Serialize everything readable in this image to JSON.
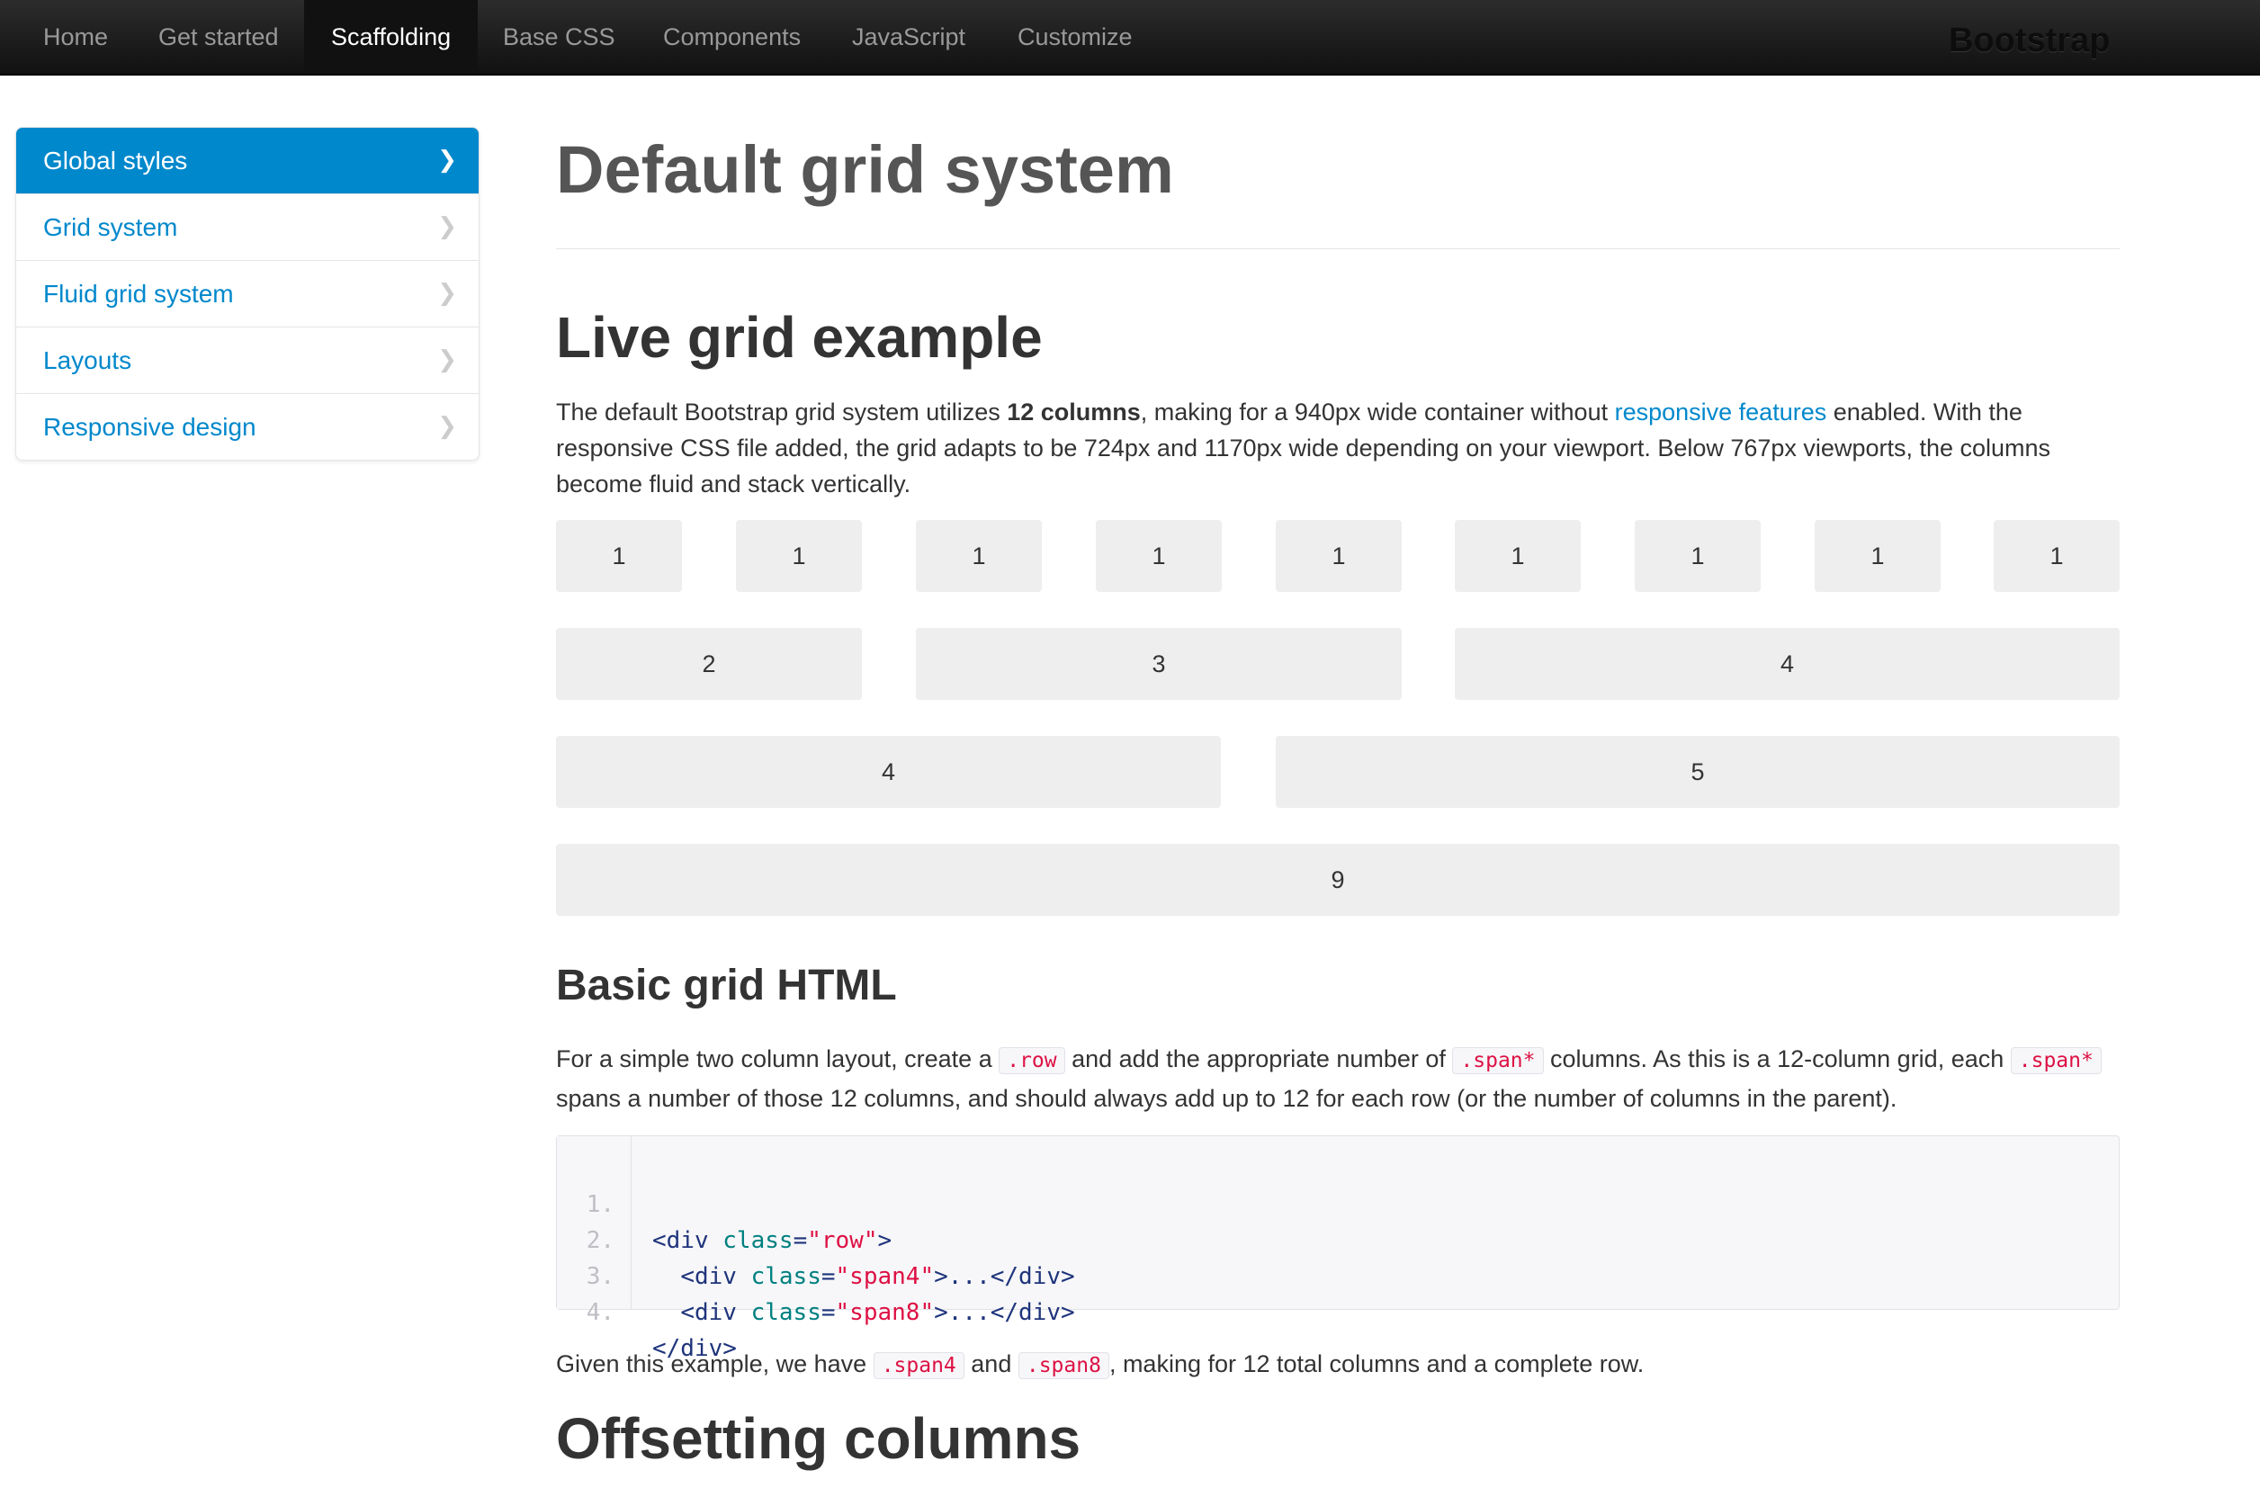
{
  "navbar": {
    "items": [
      {
        "label": "Home",
        "active": false
      },
      {
        "label": "Get started",
        "active": false
      },
      {
        "label": "Scaffolding",
        "active": true
      },
      {
        "label": "Base CSS",
        "active": false
      },
      {
        "label": "Components",
        "active": false
      },
      {
        "label": "JavaScript",
        "active": false
      },
      {
        "label": "Customize",
        "active": false
      }
    ],
    "brand": "Bootstrap"
  },
  "sidebar": {
    "items": [
      {
        "label": "Global styles",
        "active": true,
        "icon": "chevron-right-icon"
      },
      {
        "label": "Grid system",
        "active": false,
        "icon": "chevron-right-icon"
      },
      {
        "label": "Fluid grid system",
        "active": false,
        "icon": "chevron-right-icon"
      },
      {
        "label": "Layouts",
        "active": false,
        "icon": "chevron-right-icon"
      },
      {
        "label": "Responsive design",
        "active": false,
        "icon": "chevron-right-icon"
      }
    ]
  },
  "main": {
    "page_title": "Default grid system",
    "live_example": {
      "heading": "Live grid example",
      "intro": {
        "p1": "The default Bootstrap grid system utilizes ",
        "bold": "12 columns",
        "p2": ", making for a 940px wide container without ",
        "link": "responsive features",
        "p3": " enabled. With the responsive CSS file added, the grid adapts to be 724px and 1170px wide depending on your viewport. Below 767px viewports, the columns become fluid and stack vertically."
      },
      "rows": [
        [
          "1",
          "1",
          "1",
          "1",
          "1",
          "1",
          "1",
          "1",
          "1"
        ],
        [
          "2",
          "3",
          "4"
        ],
        [
          "4",
          "5"
        ],
        [
          "9"
        ]
      ]
    },
    "basic_grid": {
      "heading": "Basic grid HTML",
      "p1": "For a simple two column layout, create a ",
      "code_row": ".row",
      "p2": " and add the appropriate number of ",
      "code_span": ".span*",
      "p3": " columns. As this is a 12-column grid, each ",
      "code_span2": ".span*",
      "p4": " spans a number of those 12 columns, and should always add up to 12 for each row (or the number of columns in the parent).",
      "code_lines": [
        {
          "num": "1.",
          "indent": "",
          "tag_open": "<div ",
          "attr": "class",
          "eq": "=",
          "val": "\"row\"",
          "rest": ">"
        },
        {
          "num": "2.",
          "indent": "  ",
          "tag_open": "<div ",
          "attr": "class",
          "eq": "=",
          "val": "\"span4\"",
          "rest": ">...</div>"
        },
        {
          "num": "3.",
          "indent": "  ",
          "tag_open": "<div ",
          "attr": "class",
          "eq": "=",
          "val": "\"span8\"",
          "rest": ">...</div>"
        },
        {
          "num": "4.",
          "indent": "",
          "tag_open": "</div>",
          "attr": "",
          "eq": "",
          "val": "",
          "rest": ""
        }
      ],
      "after": {
        "p1": "Given this example, we have ",
        "code1": ".span4",
        "p2": " and ",
        "code2": ".span8",
        "p3": ", making for 12 total columns and a complete row."
      }
    },
    "offset_heading": "Offsetting columns"
  }
}
